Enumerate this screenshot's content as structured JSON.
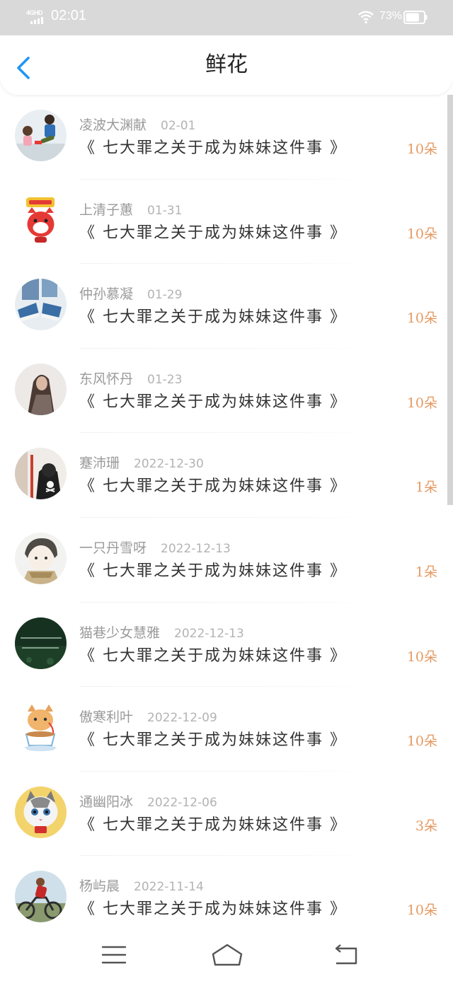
{
  "status_bar": {
    "network": "4GHD",
    "time": "02:01",
    "battery_percent": "73%",
    "battery_level": 0.73,
    "text_color": "#ffffff",
    "background": "#d9d9d9"
  },
  "nav": {
    "title": "鲜花",
    "back_icon": "chevron-left-icon",
    "back_color": "#2196f3"
  },
  "list": {
    "items": [
      {
        "name": "凌波大渊献",
        "date": "02-01",
        "title": "《 七大罪之关于成为妹妹这件事 》",
        "count": "10朵"
      },
      {
        "name": "上清子蕙",
        "date": "01-31",
        "title": "《 七大罪之关于成为妹妹这件事 》",
        "count": "10朵"
      },
      {
        "name": "仲孙慕凝",
        "date": "01-29",
        "title": "《 七大罪之关于成为妹妹这件事 》",
        "count": "10朵"
      },
      {
        "name": "东风怀丹",
        "date": "01-23",
        "title": "《 七大罪之关于成为妹妹这件事 》",
        "count": "10朵"
      },
      {
        "name": "蹇沛珊",
        "date": "2022-12-30",
        "title": "《 七大罪之关于成为妹妹这件事 》",
        "count": "1朵"
      },
      {
        "name": "一只丹雪呀",
        "date": "2022-12-13",
        "title": "《 七大罪之关于成为妹妹这件事 》",
        "count": "1朵"
      },
      {
        "name": "猫巷少女慧雅",
        "date": "2022-12-13",
        "title": "《 七大罪之关于成为妹妹这件事 》",
        "count": "10朵"
      },
      {
        "name": "傲寒利叶",
        "date": "2022-12-09",
        "title": "《 七大罪之关于成为妹妹这件事 》",
        "count": "10朵"
      },
      {
        "name": "通幽阳冰",
        "date": "2022-12-06",
        "title": "《 七大罪之关于成为妹妹这件事 》",
        "count": "3朵"
      },
      {
        "name": "杨屿晨",
        "date": "2022-11-14",
        "title": "《 七大罪之关于成为妹妹这件事 》",
        "count": "10朵"
      }
    ],
    "count_color": "#e59a63"
  },
  "system_nav": {
    "menu_icon": "menu-icon",
    "home_icon": "home-icon",
    "back_icon": "back-icon"
  }
}
